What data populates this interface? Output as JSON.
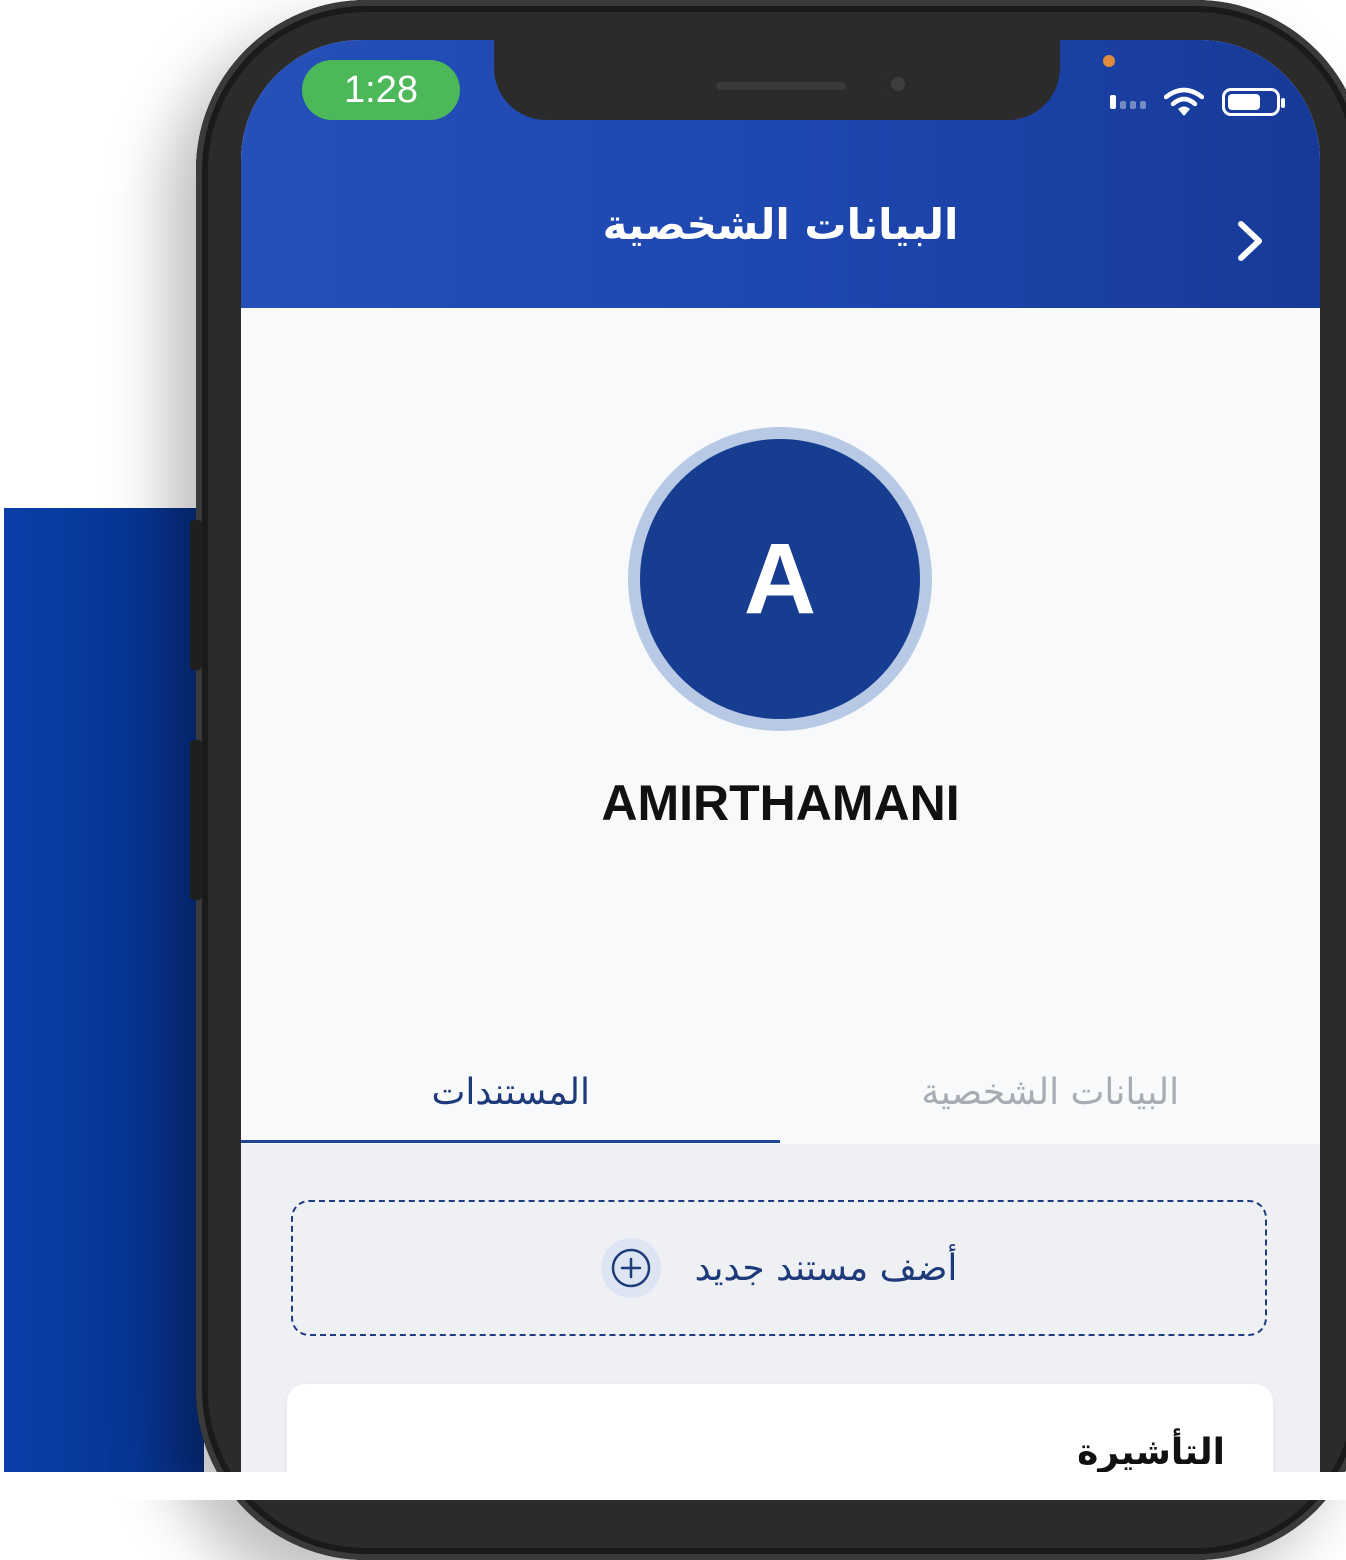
{
  "status_bar": {
    "time": "1:28",
    "signal_icon": "cellular-signal-icon",
    "wifi_icon": "wifi-icon",
    "battery_icon": "battery-icon"
  },
  "header": {
    "title": "البيانات الشخصية",
    "back_icon": "chevron-right-icon"
  },
  "profile": {
    "avatar_initial": "A",
    "name": "AMIRTHAMANI"
  },
  "tabs": [
    {
      "label": "المستندات",
      "active": true
    },
    {
      "label": "البيانات الشخصية",
      "active": false
    }
  ],
  "documents": {
    "add_label": "أضف مستند جديد",
    "add_icon": "plus-circle-icon",
    "cards": [
      {
        "title": "التأشيرة"
      }
    ]
  },
  "colors": {
    "header_blue": "#1e47b0",
    "avatar_blue": "#173d91",
    "accent_navy": "#1d3a7a",
    "status_green": "#4cb85a",
    "tab_inactive": "#a8abb3"
  }
}
